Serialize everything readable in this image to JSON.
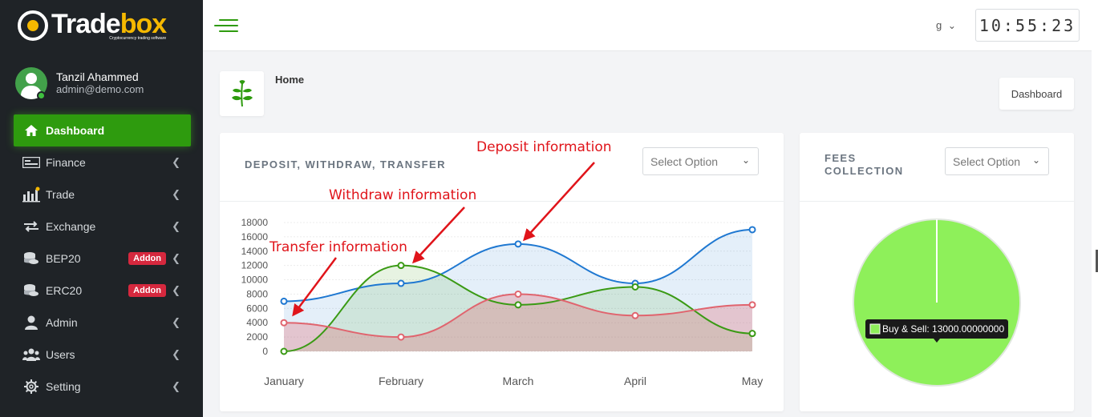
{
  "brand": {
    "name_part1": "Trade",
    "name_part2": "box",
    "tagline": "Cryptocurrency trading software"
  },
  "profile": {
    "name": "Tanzil Ahammed",
    "email": "admin@demo.com"
  },
  "sidebar": {
    "items": [
      {
        "label": "Dashboard",
        "icon": "home-icon",
        "active": true
      },
      {
        "label": "Finance",
        "icon": "money-icon"
      },
      {
        "label": "Trade",
        "icon": "chart-bar-icon"
      },
      {
        "label": "Exchange",
        "icon": "exchange-icon"
      },
      {
        "label": "BEP20",
        "icon": "coins-icon",
        "badge": "Addon"
      },
      {
        "label": "ERC20",
        "icon": "coins-icon",
        "badge": "Addon"
      },
      {
        "label": "Admin",
        "icon": "user-icon"
      },
      {
        "label": "Users",
        "icon": "users-icon"
      },
      {
        "label": "Setting",
        "icon": "gear-icon"
      }
    ]
  },
  "topbar": {
    "language": "g",
    "clock": "10:55:23"
  },
  "breadcrumb": {
    "title": "Home",
    "button": "Dashboard"
  },
  "main_card": {
    "title": "DEPOSIT, WITHDRAW, TRANSFER",
    "select_placeholder": "Select Option",
    "annotations": {
      "deposit": "Deposit information",
      "withdraw": "Withdraw information",
      "transfer": "Transfer information"
    }
  },
  "fees_card": {
    "title_line1": "FEES",
    "title_line2": "COLLECTION",
    "select_placeholder": "Select Option",
    "tooltip": "Buy & Sell: 13000.00000000"
  },
  "colors": {
    "accent": "#2e9b0e",
    "deposit": "#1f78d1",
    "withdraw": "#3a9a14",
    "transfer": "#e0646e",
    "pie": "#8ef05a"
  },
  "chart_data": [
    {
      "type": "area",
      "categories": [
        "January",
        "February",
        "March",
        "April",
        "May"
      ],
      "y_ticks": [
        "0",
        "2000",
        "4000",
        "6000",
        "8000",
        "10000",
        "12000",
        "14000",
        "16000",
        "18000"
      ],
      "ylim": [
        0,
        18000
      ],
      "series": [
        {
          "key": "deposit",
          "values": [
            7000,
            9500,
            15000,
            9500,
            17000
          ]
        },
        {
          "key": "withdraw",
          "values": [
            0,
            12000,
            6500,
            9000,
            2500
          ]
        },
        {
          "key": "transfer",
          "values": [
            4000,
            2000,
            8000,
            5000,
            6500
          ]
        }
      ]
    },
    {
      "type": "pie",
      "labels": [
        "Buy & Sell"
      ],
      "values": [
        13000
      ]
    }
  ]
}
